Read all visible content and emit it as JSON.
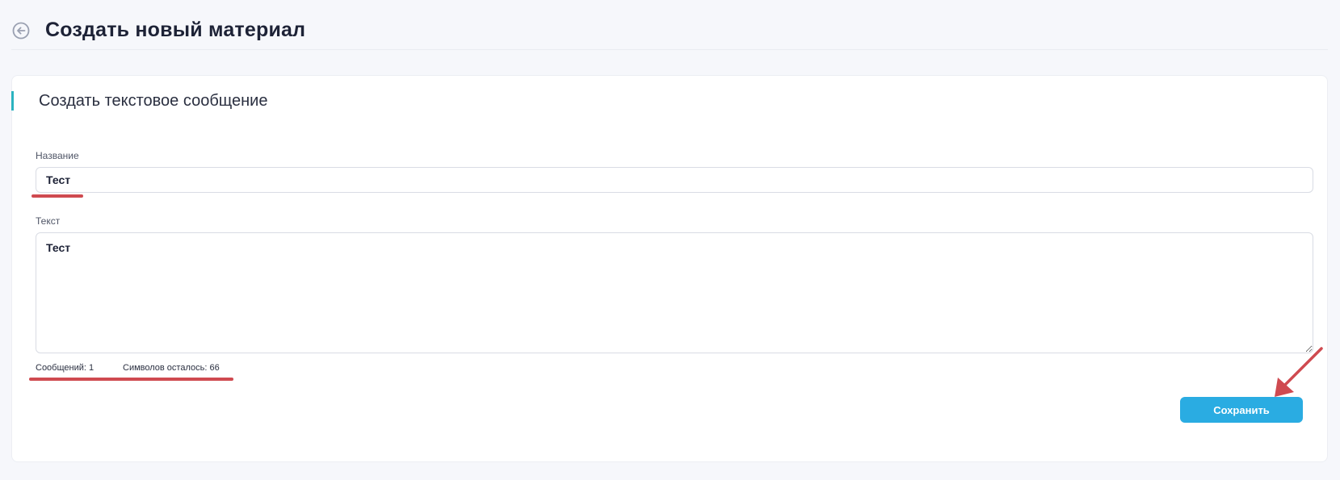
{
  "header": {
    "title": "Создать новый материал",
    "back_icon": "arrow-left-circle-icon"
  },
  "card": {
    "title": "Создать текстовое сообщение",
    "accent_color": "#2bb3c0"
  },
  "form": {
    "name_label": "Название",
    "name_value": "Тест",
    "text_label": "Текст",
    "text_value": "Тест",
    "messages_counter": "Сообщений: 1",
    "chars_counter": "Символов осталось: 66",
    "save_label": "Сохранить"
  },
  "colors": {
    "primary": "#2aace2",
    "annotation": "#cf4a50",
    "background": "#f6f7fb"
  }
}
